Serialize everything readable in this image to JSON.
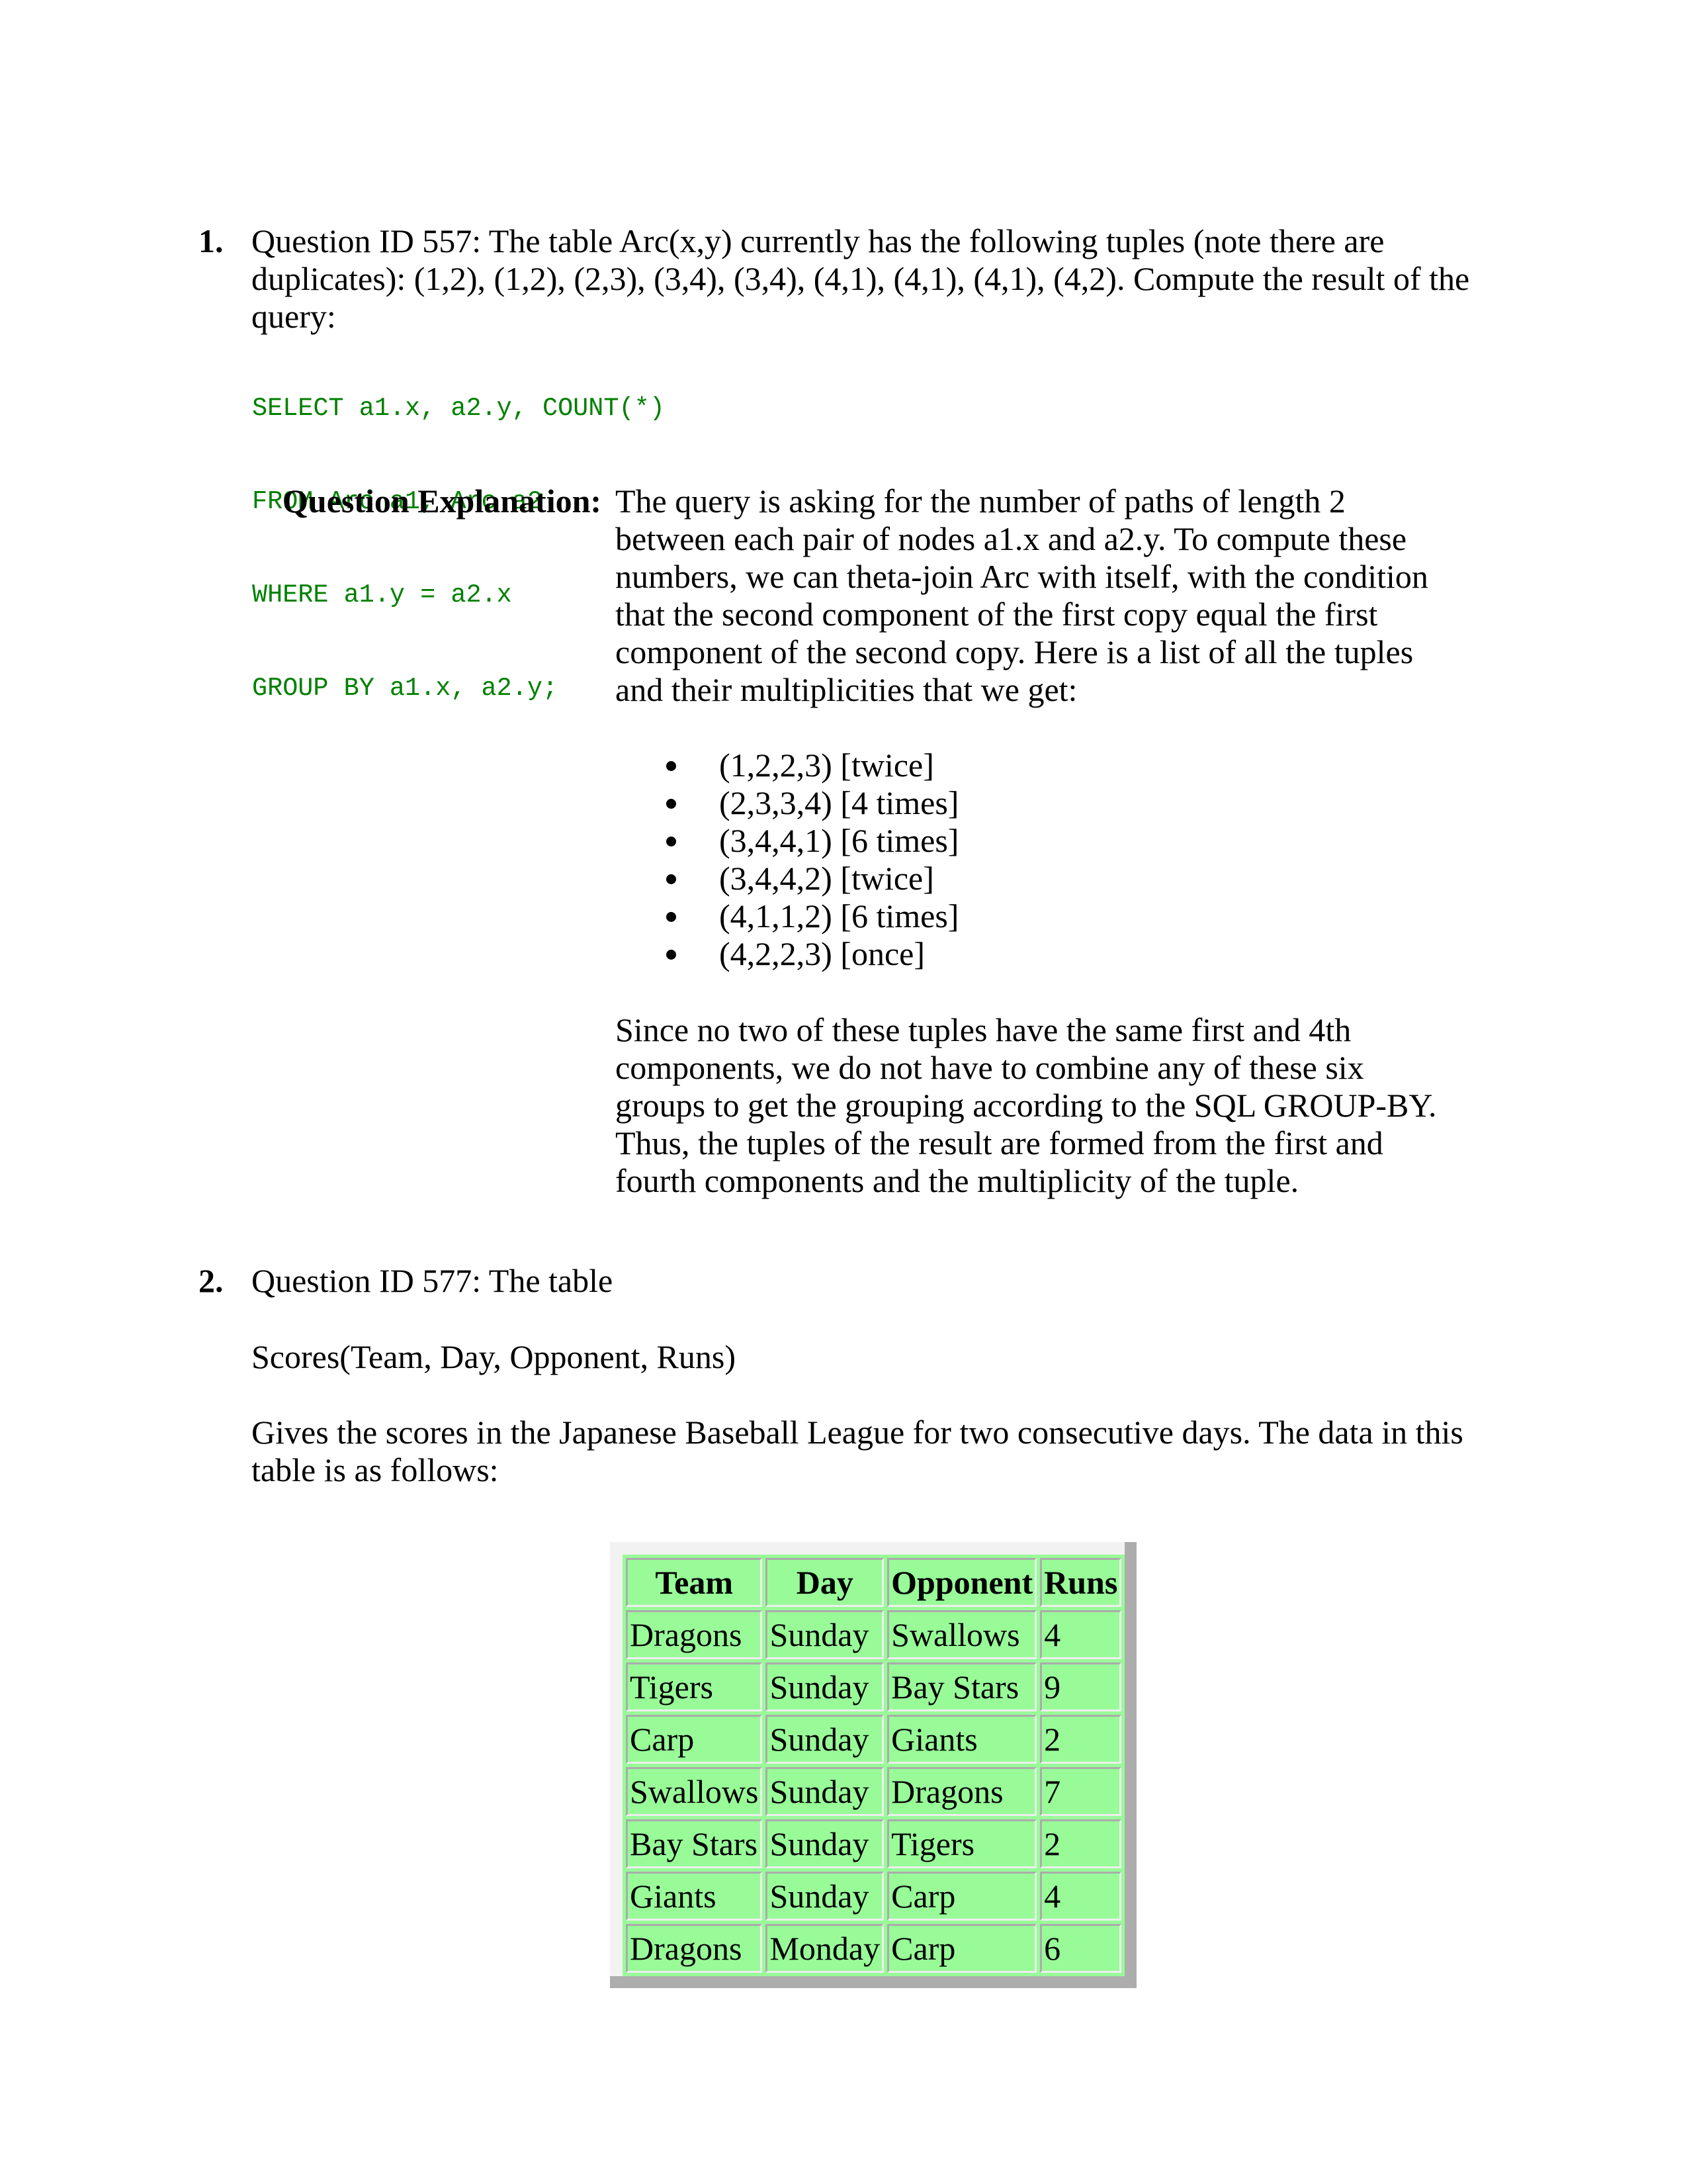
{
  "questions": [
    {
      "number": "1.",
      "prompt_lines": [
        "Question ID 557: The table Arc(x,y) currently has the following tuples (note there are",
        "duplicates): (1,2), (1,2), (2,3), (3,4), (3,4), (4,1), (4,1), (4,1), (4,2). Compute the result of the",
        "query:"
      ],
      "code_lines": [
        "SELECT a1.x, a2.y, COUNT(*)",
        "FROM Arc a1, Arc a2",
        "WHERE a1.y = a2.x",
        "GROUP BY a1.x, a2.y;"
      ],
      "explanation": {
        "label": "Question Explanation:",
        "intro_lines": [
          "The query is asking for the number of paths of length 2",
          "between each pair of nodes a1.x and a2.y. To compute these",
          "numbers, we can theta-join Arc with itself, with the condition",
          "that the second component of the first copy equal the first",
          "component of the second copy. Here is a list of all the tuples",
          "and their multiplicities that we get:"
        ],
        "bullets": [
          "(1,2,2,3) [twice]",
          "(2,3,3,4) [4 times]",
          "(3,4,4,1) [6 times]",
          "(3,4,4,2) [twice]",
          "(4,1,1,2) [6 times]",
          "(4,2,2,3) [once]"
        ],
        "conclusion_lines": [
          "Since no two of these tuples have the same first and 4th",
          "components, we do not have to combine any of these six",
          "groups to get the grouping according to the SQL GROUP-BY.",
          "Thus, the tuples of the result are formed from the first and",
          "fourth components and the multiplicity of the tuple."
        ]
      }
    },
    {
      "number": "2.",
      "prompt": "Question ID 577: The table",
      "schema": "Scores(Team, Day, Opponent, Runs)",
      "description_lines": [
        "Gives the scores in the Japanese Baseball League for two consecutive days. The data in this",
        "table is as follows:"
      ],
      "table": {
        "headers": [
          "Team",
          "Day",
          "Opponent",
          "Runs"
        ],
        "rows": [
          [
            "Dragons",
            "Sunday",
            "Swallows",
            "4"
          ],
          [
            "Tigers",
            "Sunday",
            "Bay Stars",
            "9"
          ],
          [
            "Carp",
            "Sunday",
            "Giants",
            "2"
          ],
          [
            "Swallows",
            "Sunday",
            "Dragons",
            "7"
          ],
          [
            "Bay Stars",
            "Sunday",
            "Tigers",
            "2"
          ],
          [
            "Giants",
            "Sunday",
            "Carp",
            "4"
          ],
          [
            "Dragons",
            "Monday",
            "Carp",
            "6"
          ]
        ]
      }
    }
  ],
  "colors": {
    "code_text": "#008000",
    "table_background": "#98fb98",
    "table_border_light": "#f2f2f2",
    "table_border_dark": "#adadad"
  }
}
